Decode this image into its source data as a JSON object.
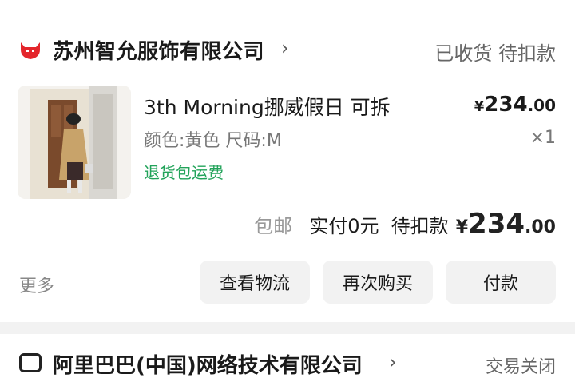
{
  "order": {
    "shop_name": "苏州智允服饰有限公司",
    "status": "已收货 待扣款",
    "product": {
      "title": "3th Morning挪威假日 可拆",
      "spec": "颜色:黄色 尺码:M",
      "tag": "退货包运费",
      "price_currency": "¥",
      "price_int": "234",
      "price_dec": ".00",
      "quantity": "×1"
    },
    "summary": {
      "shipping": "包邮",
      "paid": "实付0元",
      "pending_label": "待扣款",
      "currency": "¥",
      "amount_int": "234",
      "amount_dec": ".00"
    },
    "more_label": "更多",
    "buttons": [
      "查看物流",
      "再次购买",
      "付款"
    ]
  },
  "next_order": {
    "shop_name": "阿里巴巴(中国)网络技术有限公司",
    "status": "交易关闭"
  },
  "colors": {
    "shop_icon_red": "#e4262c",
    "tag_green": "#22a35a",
    "button_bg": "#f2f2f2"
  }
}
